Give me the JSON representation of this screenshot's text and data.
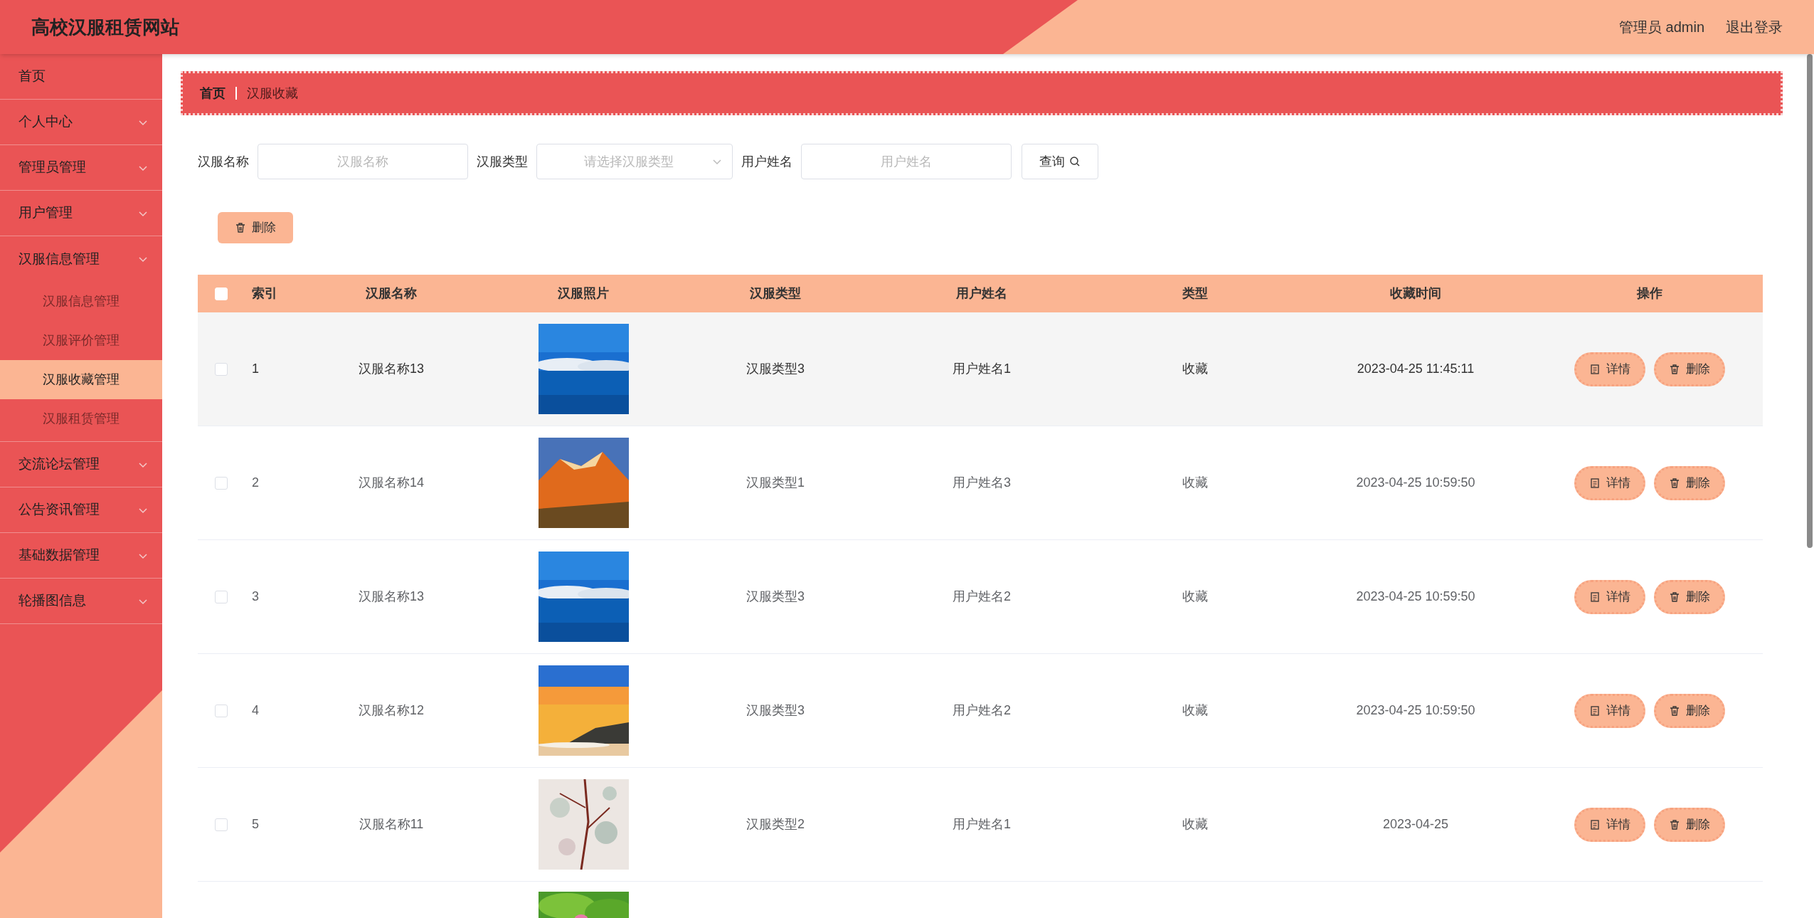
{
  "header": {
    "title": "高校汉服租赁网站",
    "user": "管理员 admin",
    "logout": "退出登录"
  },
  "sidebar": {
    "items": [
      {
        "label": "首页",
        "selected": false
      },
      {
        "label": "个人中心",
        "selected": false
      },
      {
        "label": "管理员管理",
        "selected": false
      },
      {
        "label": "用户管理",
        "selected": false
      },
      {
        "label": "汉服信息管理",
        "selected": false,
        "children": [
          {
            "label": "汉服信息管理",
            "selected": false
          },
          {
            "label": "汉服评价管理",
            "selected": false
          },
          {
            "label": "汉服收藏管理",
            "selected": true
          },
          {
            "label": "汉服租赁管理",
            "selected": false
          }
        ]
      },
      {
        "label": "交流论坛管理",
        "selected": false
      },
      {
        "label": "公告资讯管理",
        "selected": false
      },
      {
        "label": "基础数据管理",
        "selected": false
      },
      {
        "label": "轮播图信息",
        "selected": false
      }
    ]
  },
  "breadcrumb": [
    "首页",
    "汉服收藏"
  ],
  "search": {
    "fields": [
      {
        "label": "汉服名称",
        "placeholder": "汉服名称",
        "kind": "text"
      },
      {
        "label": "汉服类型",
        "placeholder": "请选择汉服类型",
        "kind": "select"
      },
      {
        "label": "用户姓名",
        "placeholder": "用户姓名",
        "kind": "text"
      }
    ],
    "button": "查询"
  },
  "delete_button": "删除",
  "table": {
    "columns": [
      "索引",
      "汉服名称",
      "汉服照片",
      "汉服类型",
      "用户姓名",
      "类型",
      "收藏时间",
      "操作"
    ],
    "header_checked": false,
    "rows": [
      {
        "index": "1",
        "name": "汉服名称13",
        "type": "汉服类型3",
        "user": "用户姓名1",
        "kind": "收藏",
        "time": "2023-04-25 11:45:11",
        "checked": false,
        "highlighted": true,
        "actions": [
          "详情",
          "删除"
        ]
      },
      {
        "index": "2",
        "name": "汉服名称14",
        "type": "汉服类型1",
        "user": "用户姓名3",
        "kind": "收藏",
        "time": "2023-04-25 10:59:50",
        "checked": false,
        "highlighted": false,
        "actions": [
          "详情",
          "删除"
        ]
      },
      {
        "index": "3",
        "name": "汉服名称13",
        "type": "汉服类型3",
        "user": "用户姓名2",
        "kind": "收藏",
        "time": "2023-04-25 10:59:50",
        "checked": false,
        "highlighted": false,
        "actions": [
          "详情",
          "删除"
        ]
      },
      {
        "index": "4",
        "name": "汉服名称12",
        "type": "汉服类型3",
        "user": "用户姓名2",
        "kind": "收藏",
        "time": "2023-04-25 10:59:50",
        "checked": false,
        "highlighted": false,
        "actions": [
          "详情",
          "删除"
        ]
      },
      {
        "index": "5",
        "name": "汉服名称11",
        "type": "汉服类型2",
        "user": "用户姓名1",
        "kind": "收藏",
        "time": "2023-04-25",
        "checked": false,
        "highlighted": false,
        "actions": [
          "详情",
          "删除"
        ]
      }
    ]
  }
}
